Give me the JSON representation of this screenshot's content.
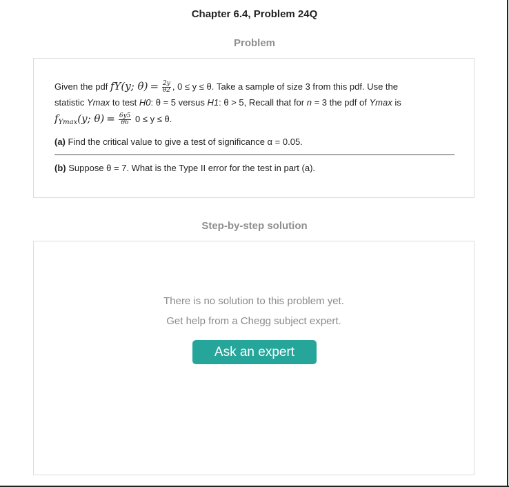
{
  "chapter_title": "Chapter 6.4, Problem 24Q",
  "problem_label": "Problem",
  "problem": {
    "line1_intro": "Given the pdf",
    "line1_pdf_lhs": "fY(y; θ)",
    "line1_frac_num": "2y",
    "line1_frac_den": "θ2",
    "line1_rest": "0 ≤ y ≤ θ. Take a sample of size 3 from this pdf. Use the",
    "line2_a": "statistic",
    "line2_ymax": "Ymax",
    "line2_b": "to test",
    "line2_h0": "H0",
    "line2_c": ": θ = 5 versus",
    "line2_h1": "H1",
    "line2_d": ": θ > 5, Recall that for",
    "line2_n": "n",
    "line2_e": "= 3 the pdf of",
    "line2_ymax2": "Ymax",
    "line2_f": "is",
    "line3_f": "f",
    "line3_sub": "Ymax",
    "line3_args": "(y; θ)",
    "line3_frac_num": "6y5",
    "line3_frac_den": "θ6",
    "line3_rest": "0 ≤ y ≤ θ.",
    "part_a_label": "(a)",
    "part_a_text": "Find the critical value to give a test of significance α = 0.05.",
    "part_b_label": "(b)",
    "part_b_text": "Suppose θ = 7. What is the Type II error for the test in part (a)."
  },
  "solution_label": "Step-by-step solution",
  "solution": {
    "empty_line1": "There is no solution to this problem yet.",
    "empty_line2": "Get help from a Chegg subject expert.",
    "ask_button": "Ask an expert"
  }
}
